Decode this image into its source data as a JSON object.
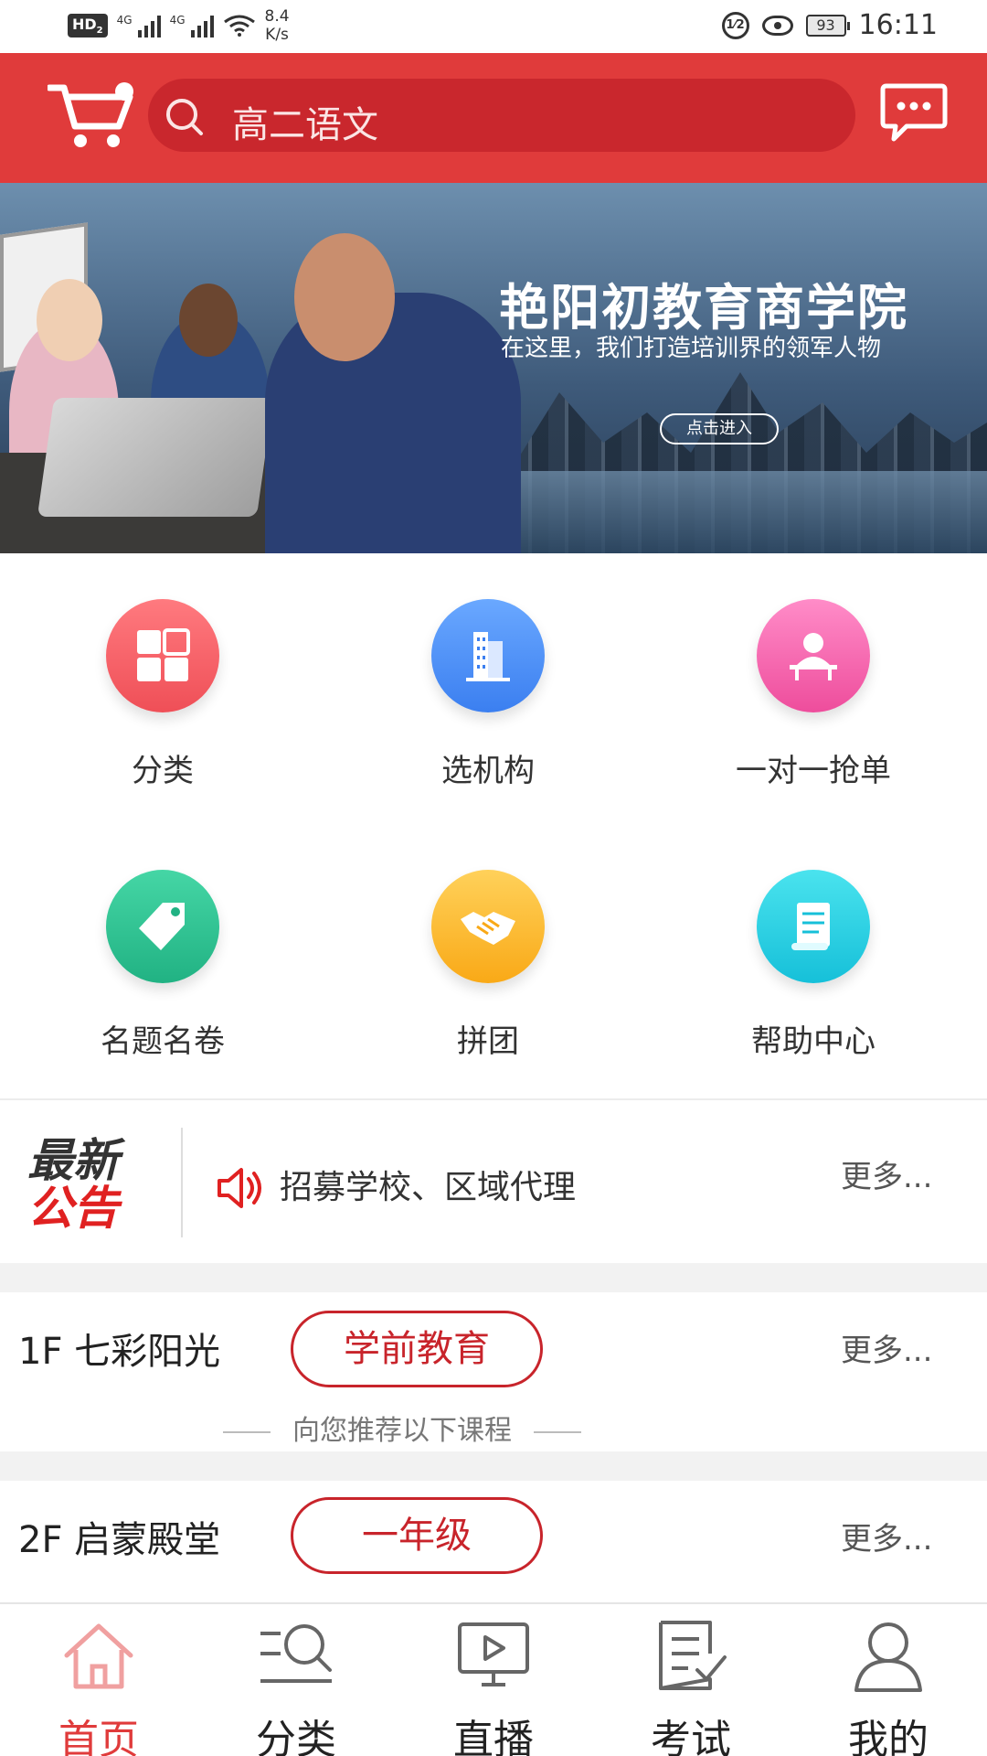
{
  "status_bar": {
    "left_chip": "HD",
    "left_chip_sub": "2",
    "net1": "4G",
    "net2": "4G",
    "speed_value": "8.4",
    "speed_unit": "K/s",
    "battery": "93",
    "time": "16:11"
  },
  "header": {
    "search_placeholder": "高二语文"
  },
  "banner": {
    "title": "艳阳初教育商学院",
    "subtitle": "在这里，我们打造培训界的领军人物",
    "button": "点击进入"
  },
  "menu": [
    {
      "label": "分类",
      "icon": "grid-icon",
      "color": "#ef4f57"
    },
    {
      "label": "选机构",
      "icon": "building-icon",
      "color": "#3b7ff0"
    },
    {
      "label": "一对一抢单",
      "icon": "teacher-icon",
      "color": "#ee4d9c"
    },
    {
      "label": "名题名卷",
      "icon": "tag-icon",
      "color": "#21b283"
    },
    {
      "label": "拼团",
      "icon": "handshake-icon",
      "color": "#f9a917"
    },
    {
      "label": "帮助中心",
      "icon": "scroll-icon",
      "color": "#16c0d9"
    }
  ],
  "notice": {
    "logo_line1": "最新",
    "logo_line2": "公告",
    "text": "招募学校、区域代理",
    "more": "更多..."
  },
  "floors": [
    {
      "title": "1F 七彩阳光",
      "tag": "学前教育",
      "more": "更多...",
      "recommend": "向您推荐以下课程"
    },
    {
      "title": "2F 启蒙殿堂",
      "tag": "一年级",
      "more": "更多..."
    }
  ],
  "tabs": [
    {
      "label": "首页",
      "icon": "home-icon",
      "active": true
    },
    {
      "label": "分类",
      "icon": "category-search-icon",
      "active": false
    },
    {
      "label": "直播",
      "icon": "live-play-icon",
      "active": false
    },
    {
      "label": "考试",
      "icon": "exam-icon",
      "active": false
    },
    {
      "label": "我的",
      "icon": "profile-icon",
      "active": false
    }
  ],
  "colors": {
    "brand_red": "#e03b3b",
    "search_bg": "#c9272d",
    "tag_red": "#c8242b"
  }
}
